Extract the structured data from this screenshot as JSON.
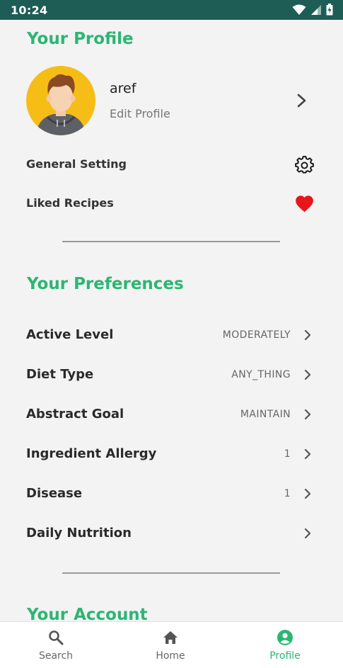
{
  "status_bar": {
    "time": "10:24"
  },
  "profile": {
    "section_title": "Your Profile",
    "name": "aref",
    "edit_label": "Edit Profile",
    "settings": [
      {
        "label": "General Setting",
        "icon": "gear-icon"
      },
      {
        "label": "Liked Recipes",
        "icon": "heart-icon"
      }
    ]
  },
  "preferences": {
    "section_title": "Your Preferences",
    "rows": [
      {
        "label": "Active Level",
        "value": "MODERATELY"
      },
      {
        "label": "Diet Type",
        "value": "ANY_THING"
      },
      {
        "label": "Abstract Goal",
        "value": "MAINTAIN"
      },
      {
        "label": "Ingredient Allergy",
        "value": "1"
      },
      {
        "label": "Disease",
        "value": "1"
      },
      {
        "label": "Daily Nutrition",
        "value": ""
      }
    ]
  },
  "account": {
    "section_title": "Your Account"
  },
  "bottom_nav": {
    "items": [
      {
        "label": "Search",
        "icon": "search-icon"
      },
      {
        "label": "Home",
        "icon": "home-icon"
      },
      {
        "label": "Profile",
        "icon": "profile-icon"
      }
    ],
    "active_index": 2
  },
  "colors": {
    "accent": "#2bb673",
    "status_bar": "#1d5d55",
    "heart": "#e8151b",
    "avatar_bg": "#f6bd16"
  }
}
